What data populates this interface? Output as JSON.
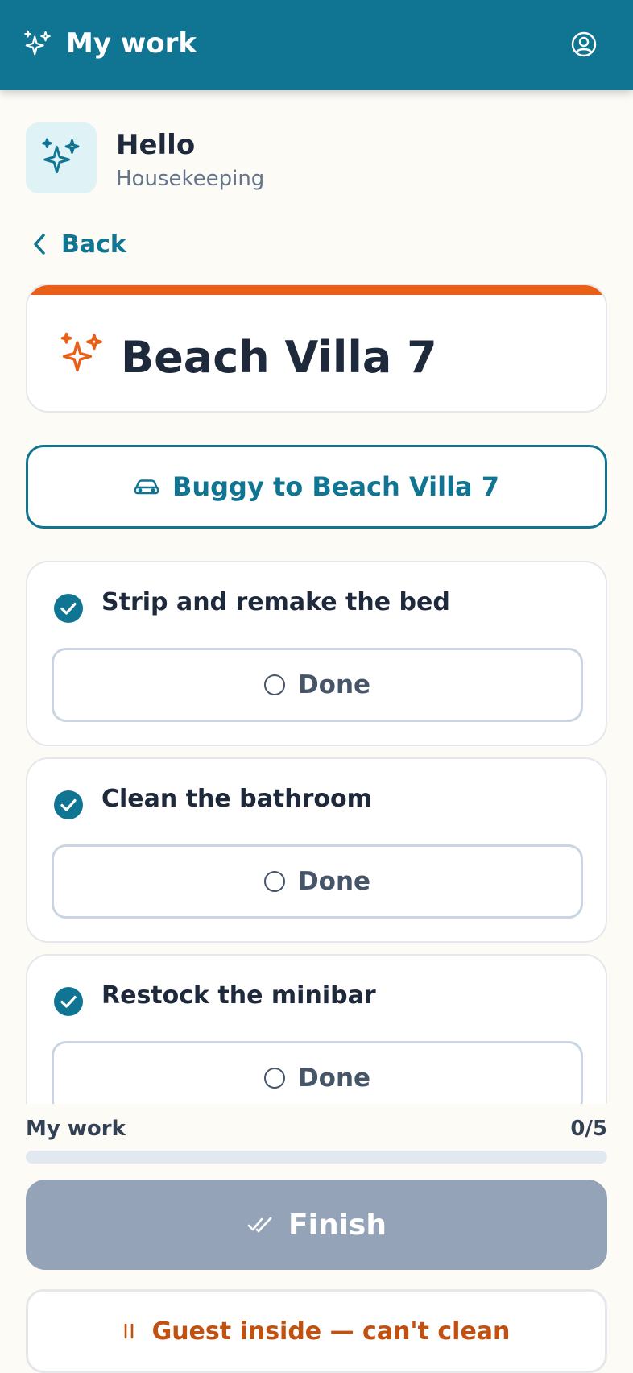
{
  "header": {
    "title": "My work",
    "brand_icon": "sparkles-icon",
    "profile_icon": "user-circle-icon",
    "background": "#0f7592"
  },
  "greeting": {
    "title": "Hello",
    "subtitle": "Housekeeping",
    "icon": "sparkles-icon"
  },
  "back": {
    "label": "Back",
    "icon": "chevron-left-icon"
  },
  "room": {
    "name": "Beach Villa 7",
    "icon": "sparkles-icon",
    "accent_color": "#ea5f17"
  },
  "buggy": {
    "label": "Buggy to Beach Villa 7",
    "icon": "car-icon"
  },
  "tasks": [
    {
      "label": "Strip and remake the bed",
      "done_label": "Done",
      "checked": true
    },
    {
      "label": "Clean the bathroom",
      "done_label": "Done",
      "checked": true
    },
    {
      "label": "Restock the minibar",
      "done_label": "Done",
      "checked": true
    }
  ],
  "progress": {
    "label": "My work",
    "count": "0/5",
    "completed": 0,
    "total": 5
  },
  "finish": {
    "label": "Finish",
    "icon": "double-check-icon",
    "enabled": false
  },
  "guest_inside": {
    "label": "Guest inside — can't clean",
    "icon": "pause-icon"
  },
  "colors": {
    "primary": "#0f7592",
    "accent": "#ea5f17",
    "disabled": "#94a3b8",
    "warning_text": "#c2500f"
  }
}
